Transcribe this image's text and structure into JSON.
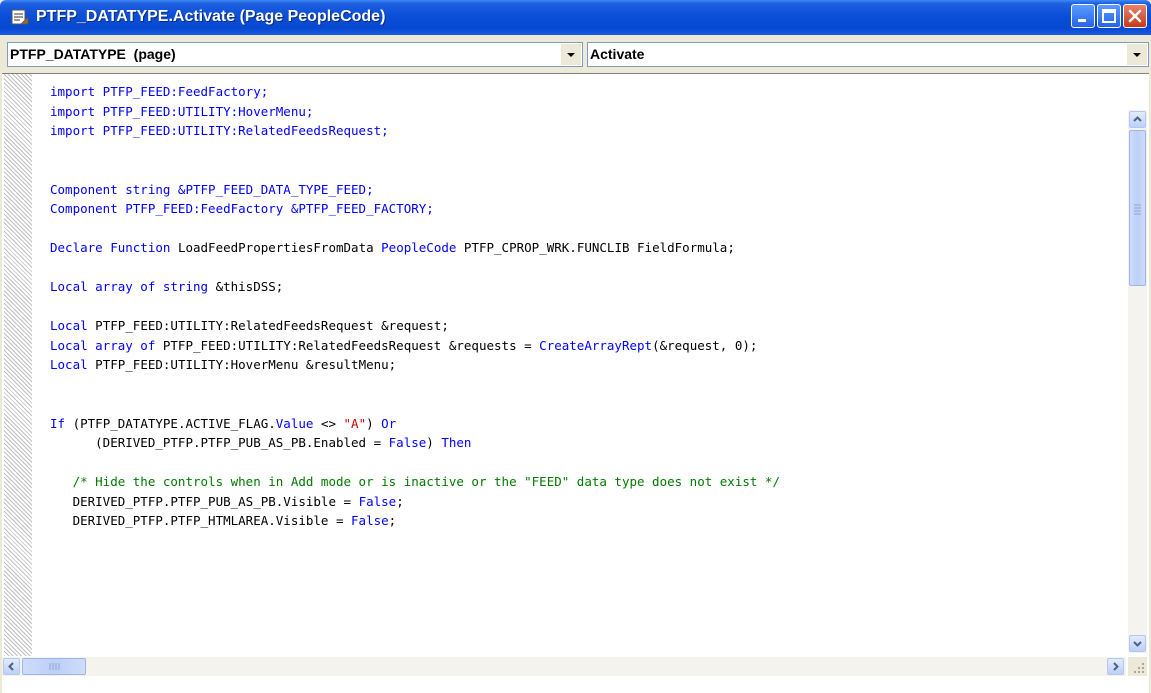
{
  "window": {
    "title": "PTFP_DATATYPE.Activate (Page PeopleCode)",
    "title_icon": "peoplecode-page-icon"
  },
  "selectors": {
    "object": "PTFP_DATATYPE  (page)",
    "event": "Activate"
  },
  "code_lines": [
    [
      {
        "t": "import PTFP_FEED:FeedFactory;",
        "c": "kw"
      }
    ],
    [
      {
        "t": "import PTFP_FEED:UTILITY:HoverMenu;",
        "c": "kw"
      }
    ],
    [
      {
        "t": "import PTFP_FEED:UTILITY:RelatedFeedsRequest;",
        "c": "kw"
      }
    ],
    [],
    [],
    [
      {
        "t": "Component string &PTFP_FEED_DATA_TYPE_FEED;",
        "c": "kw"
      }
    ],
    [
      {
        "t": "Component PTFP_FEED:FeedFactory &PTFP_FEED_FACTORY;",
        "c": "kw"
      }
    ],
    [],
    [
      {
        "t": "Declare Function",
        "c": "kw"
      },
      {
        "t": " LoadFeedPropertiesFromData ",
        "c": "t"
      },
      {
        "t": "PeopleCode",
        "c": "kw"
      },
      {
        "t": " PTFP_CPROP_WRK.FUNCLIB FieldFormula;",
        "c": "t"
      }
    ],
    [],
    [
      {
        "t": "Local array of string",
        "c": "kw"
      },
      {
        "t": " &thisDSS;",
        "c": "t"
      }
    ],
    [],
    [
      {
        "t": "Local",
        "c": "kw"
      },
      {
        "t": " PTFP_FEED:UTILITY:RelatedFeedsRequest &request;",
        "c": "t"
      }
    ],
    [
      {
        "t": "Local array of",
        "c": "kw"
      },
      {
        "t": " PTFP_FEED:UTILITY:RelatedFeedsRequest &requests = ",
        "c": "t"
      },
      {
        "t": "CreateArrayRept",
        "c": "kw"
      },
      {
        "t": "(&request, 0);",
        "c": "t"
      }
    ],
    [
      {
        "t": "Local",
        "c": "kw"
      },
      {
        "t": " PTFP_FEED:UTILITY:HoverMenu &resultMenu;",
        "c": "t"
      }
    ],
    [],
    [],
    [
      {
        "t": "If",
        "c": "kw"
      },
      {
        "t": " (PTFP_DATATYPE.ACTIVE_FLAG.",
        "c": "t"
      },
      {
        "t": "Value",
        "c": "kw"
      },
      {
        "t": " <> ",
        "c": "t"
      },
      {
        "t": "\"A\"",
        "c": "st"
      },
      {
        "t": ") ",
        "c": "t"
      },
      {
        "t": "Or",
        "c": "kw"
      }
    ],
    [
      {
        "t": "      (DERIVED_PTFP.PTFP_PUB_AS_PB.Enabled = ",
        "c": "t"
      },
      {
        "t": "False",
        "c": "kw"
      },
      {
        "t": ") ",
        "c": "t"
      },
      {
        "t": "Then",
        "c": "kw"
      }
    ],
    [],
    [
      {
        "t": "   /* Hide the controls when in Add mode or is inactive or the \"FEED\" data type does not exist */",
        "c": "cm"
      }
    ],
    [
      {
        "t": "   DERIVED_PTFP.PTFP_PUB_AS_PB.Visible = ",
        "c": "t"
      },
      {
        "t": "False",
        "c": "kw"
      },
      {
        "t": ";",
        "c": "t"
      }
    ],
    [
      {
        "t": "   DERIVED_PTFP.PTFP_HTMLAREA.Visible = ",
        "c": "t"
      },
      {
        "t": "False",
        "c": "kw"
      },
      {
        "t": ";",
        "c": "t"
      }
    ]
  ],
  "colors": {
    "keyword": "#0000ff",
    "comment": "#007a00",
    "string": "#d00000",
    "plain": "#000000",
    "titlebar": "#0a4fd8"
  }
}
